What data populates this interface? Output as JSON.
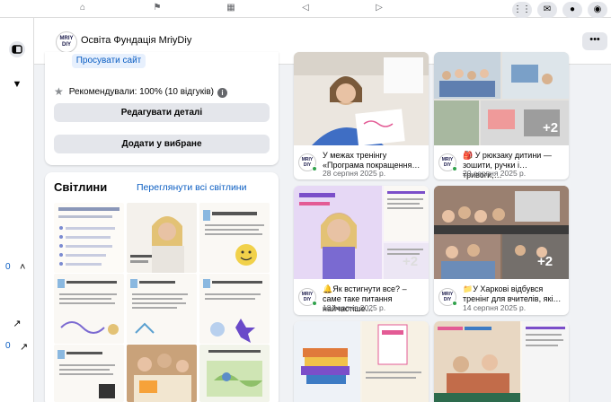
{
  "page": {
    "title": "Освіта Фундація MriyDiy",
    "logo_text": "MRIY DIY"
  },
  "intro": {
    "promote_label": "Просувати сайт",
    "recommend_text": "Рекомендували: 100% (10 відгуків)",
    "edit_label": "Редагувати деталі",
    "favorite_label": "Додати у вибране"
  },
  "photos": {
    "title": "Світлини",
    "see_all": "Переглянути всі світлини"
  },
  "posts": [
    {
      "text": "У межах тренінгу «Програма покращення…",
      "date": "28 серпня 2025 р.",
      "more": ""
    },
    {
      "text": "🎒 У рюкзаку дитини — зошити, ручки і… тривоги,…",
      "date": "20 серпня 2025 р.",
      "more": "+2"
    },
    {
      "text": "🔔Як встигнути все? – саме таке питання найчастіше…",
      "date": "18 серпня 2025 р.",
      "more": "+2"
    },
    {
      "text": "📁У Харкові відбувся тренінг для вчителів, які…",
      "date": "14 серпня 2025 р.",
      "more": "+2"
    }
  ],
  "side_labels": {
    "zero_a": "0",
    "zero_b": "0"
  },
  "colors": {
    "accent": "#0a5dc2",
    "frame": "#f5c518",
    "online": "#31a24c"
  }
}
